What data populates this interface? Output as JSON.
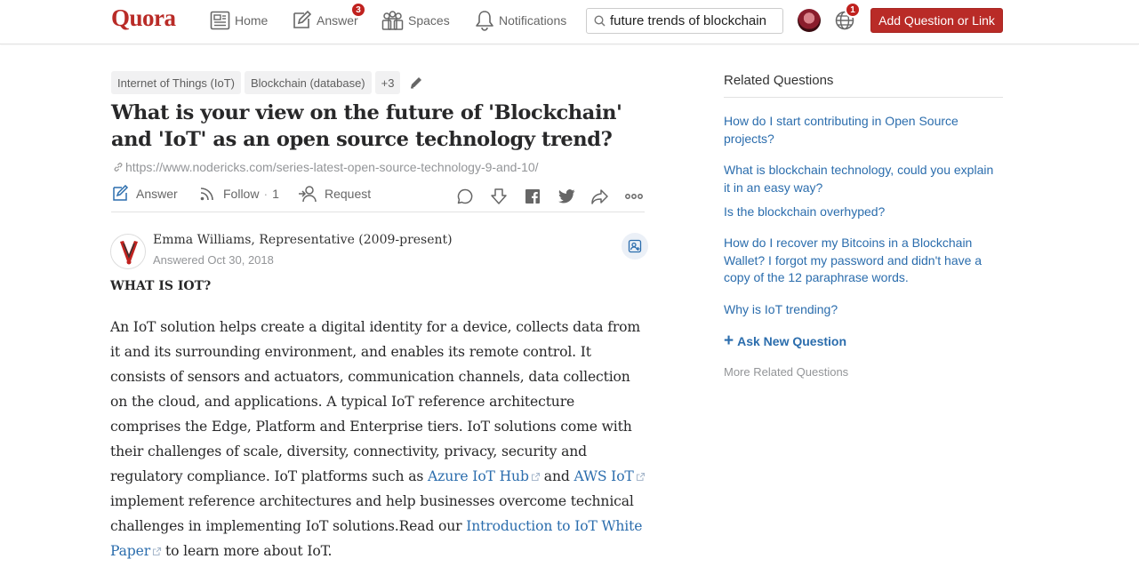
{
  "header": {
    "logo": "Quora",
    "nav": {
      "home": "Home",
      "answer": "Answer",
      "answer_badge": "3",
      "spaces": "Spaces",
      "notifications": "Notifications"
    },
    "search_value": "future trends of blockchain",
    "globe_badge": "1",
    "add_button": "Add Question or Link"
  },
  "question": {
    "tags": [
      "Internet of Things (IoT)",
      "Blockchain (database)",
      "+3"
    ],
    "title": "What is your view on the future of 'Blockchain' and 'IoT' as an open source technology trend?",
    "link": "https://www.nodericks.com/series-latest-open-source-technology-9-and-10/",
    "actions": {
      "answer": "Answer",
      "follow": "Follow",
      "follow_sep": "·",
      "follow_count": "1",
      "request": "Request"
    }
  },
  "answer": {
    "author": "Emma Williams, Representative (2009-present)",
    "date": "Answered Oct 30, 2018",
    "heading": "WHAT IS IOT?",
    "body_1": "An IoT solution helps create a digital identity for a device, collects data from it and its surrounding environment, and enables its remote control. It consists of sensors and actuators, communication channels, data collection on the cloud, and applications. A typical IoT reference architecture comprises the Edge, Platform and Enterprise tiers. IoT solutions come with their challenges of scale, diversity, connectivity, privacy, security and regulatory compliance. IoT platforms such as",
    "link_1": "Azure IoT Hub",
    "body_2": "and",
    "link_2": "AWS IoT",
    "body_3": "implement reference architectures and help businesses overcome technical challenges in implementing IoT solutions.Read our",
    "link_3": "Introduction to IoT White Paper",
    "body_4": "to learn more about IoT."
  },
  "sidebar": {
    "title": "Related Questions",
    "questions": [
      "How do I start contributing in Open Source projects?",
      "What is blockchain technology, could you explain it in an easy way?",
      "Is the blockchain overhyped?",
      "How do I recover my Bitcoins in a Blockchain Wallet? I forgot my password and didn't have a copy of the 12 paraphrase words.",
      "Why is IoT trending?"
    ],
    "ask_new": "Ask New Question",
    "more": "More Related Questions"
  },
  "colors": {
    "brand": "#b92b27",
    "link": "#2b6dad",
    "muted": "#939598"
  },
  "icons": [
    "home-icon",
    "answer-pencil-icon",
    "spaces-icon",
    "bell-icon",
    "search-icon",
    "globe-icon",
    "edit-icon",
    "link-icon",
    "follow-icon",
    "request-icon",
    "comment-icon",
    "downvote-icon",
    "facebook-icon",
    "twitter-icon",
    "share-icon",
    "more-icon",
    "external-link-icon"
  ]
}
